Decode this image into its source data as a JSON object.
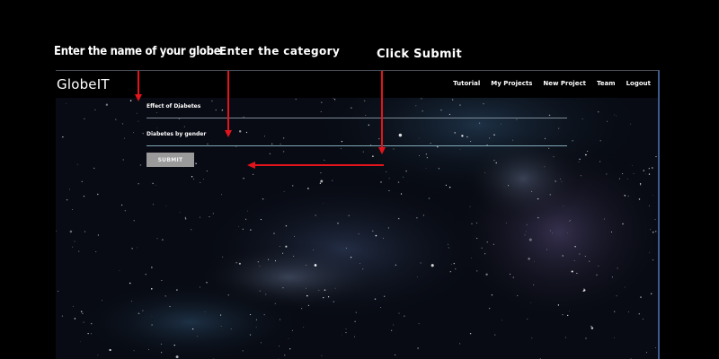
{
  "annotations": {
    "name_hint": "Enter the name of your globe",
    "category_hint": "Enter the category",
    "submit_hint": "Click Submit",
    "arrow_color": "#e3141b"
  },
  "app": {
    "brand": "GlobeIT",
    "nav": [
      "Tutorial",
      "My Projects",
      "New Project",
      "Team",
      "Logout"
    ]
  },
  "form": {
    "globe_name": {
      "value": "Effect of Diabetes"
    },
    "category": {
      "value": "Diabetes by gender"
    },
    "submit_label": "SUBMIT"
  },
  "colors": {
    "page_bg": "#000000",
    "nav_bg": "#000000",
    "button_bg": "#9a9a9a",
    "accent_border": "#3d5a8c"
  }
}
